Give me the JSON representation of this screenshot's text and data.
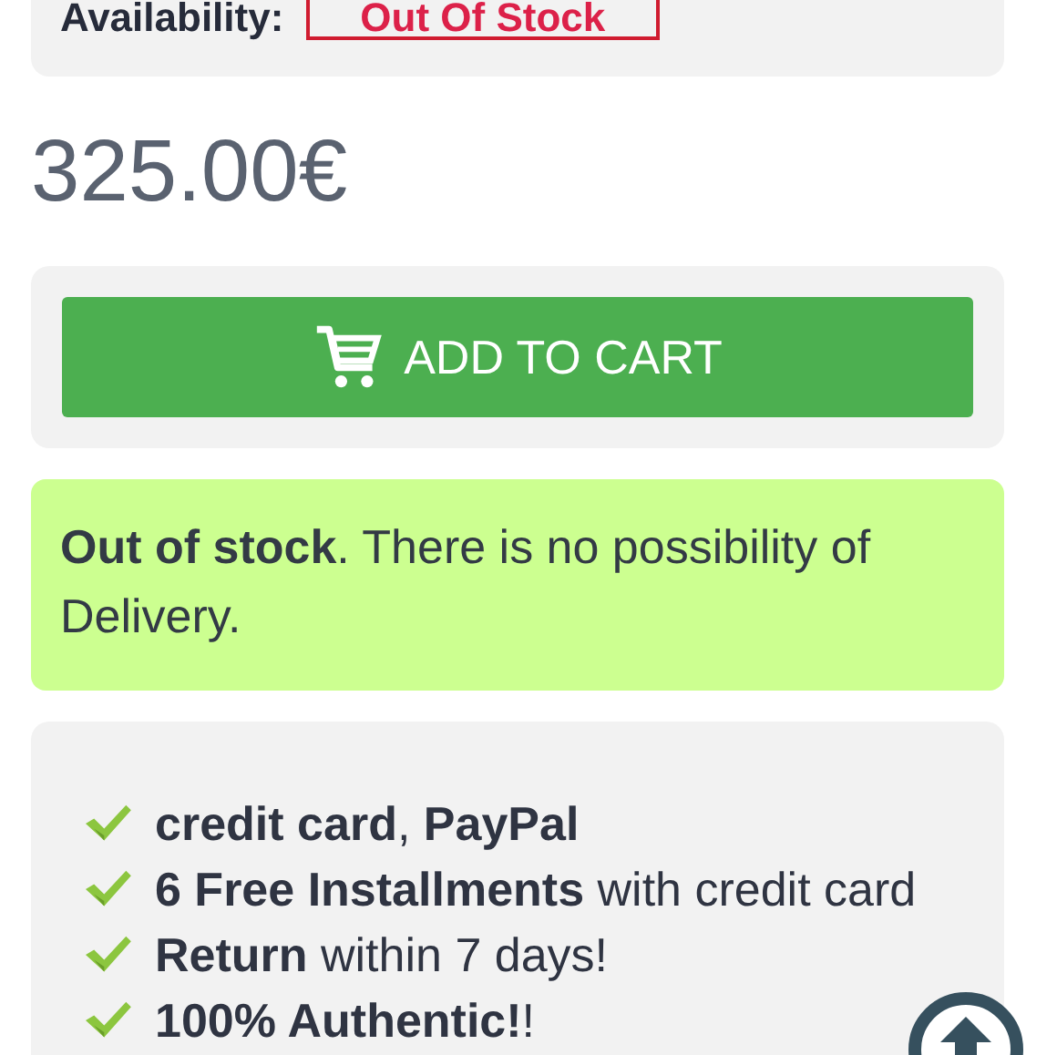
{
  "availability": {
    "label": "Availability:",
    "badge": "Out Of Stock"
  },
  "price": "325.00€",
  "add_to_cart": {
    "label": "ADD TO CART"
  },
  "stock_notice": "**Out of stock**. There is no possibility of Delivery.",
  "features": [
    {
      "text": "**credit card**, **PayPal**"
    },
    {
      "text": "**6 Free Installments** with credit card"
    },
    {
      "text": "**Return** within 7 days!"
    },
    {
      "text": "**100% Authentic!**!"
    }
  ]
}
